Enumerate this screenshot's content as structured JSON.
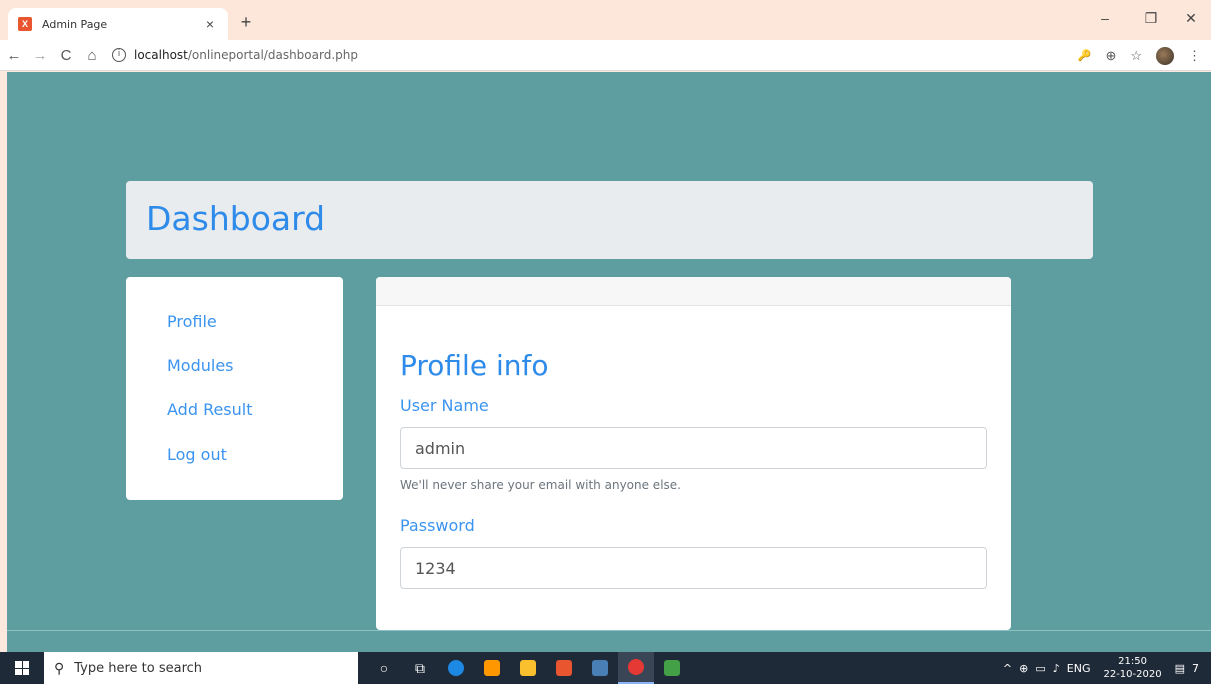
{
  "browser": {
    "tab_title": "Admin Page",
    "tab_close": "×",
    "new_tab": "+",
    "url_host": "localhost",
    "url_path": "/onlineportal/dashboard.php",
    "controls": {
      "minimize": "–",
      "restore": "❐",
      "close": "✕"
    },
    "nav": {
      "back": "←",
      "forward": "→",
      "reload": "C",
      "home": "⌂"
    },
    "toolbar_icons": {
      "key": "🔑",
      "zoom": "⊕",
      "star": "☆",
      "menu": "⋮"
    }
  },
  "dashboard": {
    "title": "Dashboard",
    "sidebar": {
      "items": [
        {
          "label": "Profile"
        },
        {
          "label": "Modules"
        },
        {
          "label": "Add Result"
        },
        {
          "label": "Log out"
        }
      ]
    },
    "profile": {
      "heading": "Profile info",
      "username_label": "User Name",
      "username_value": "admin",
      "help_text": "We'll never share your email with anyone else.",
      "password_label": "Password",
      "password_value": "1234"
    }
  },
  "taskbar": {
    "search_placeholder": "Type here to search",
    "language": "ENG",
    "time": "21:50",
    "date": "22-10-2020",
    "notifications": "7",
    "colors": {
      "edge": "#1e88e5",
      "sublime": "#ff9800",
      "explorer": "#fbc02d",
      "xampp": "#e8552e",
      "python": "#4a7fb5",
      "chrome": "#e53935",
      "app": "#43a047"
    }
  },
  "colors": {
    "page_bg": "#5f9ea0",
    "accent": "#2e8bea",
    "header_card": "#e9ecef"
  }
}
